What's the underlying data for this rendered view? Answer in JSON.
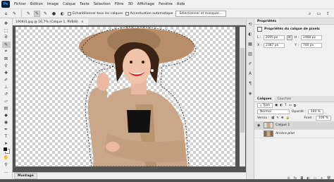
{
  "app": {
    "logo": "Ps"
  },
  "menu": [
    "Fichier",
    "Edition",
    "Image",
    "Calque",
    "Texte",
    "Sélection",
    "Filtre",
    "3D",
    "Affichage",
    "Fenêtre",
    "Aide"
  ],
  "options": {
    "sample_all_layers": "Echantillonner tous les calques",
    "auto_enhance": "Accentuation automatique",
    "select_and_mask": "Sélectionner et masquer..."
  },
  "document": {
    "tab_title": "1904/4.jpg @ 16,7% (Calque 1, RVB/8)",
    "close_glyph": "×"
  },
  "status": {
    "mini_bridge": "Montage"
  },
  "properties": {
    "tab": "Propriétés",
    "title": "Propriétés du calque de pixels",
    "w_label": "L :",
    "w_value": "2095 px",
    "h_label": "H :",
    "h_value": "2468 px",
    "x_label": "X :",
    "x_value": "2387 px",
    "y_label": "Y :",
    "y_value": "740 px"
  },
  "layers_panel": {
    "tabs": [
      "Calques",
      "Couches"
    ],
    "filter_label": "Type",
    "blend_mode": "Normal",
    "opacity_label": "Opacité :",
    "opacity_value": "100 %",
    "lock_label": "Verrou :",
    "fill_label": "Fond :",
    "fill_value": "100 %",
    "layers": [
      {
        "name": "Calque 1",
        "selected": true
      },
      {
        "name": "Arrière-plan",
        "selected": false
      }
    ]
  },
  "colors": {
    "accent": "#31a8ff",
    "coat": "#c9a788",
    "hat": "#b88d68"
  }
}
